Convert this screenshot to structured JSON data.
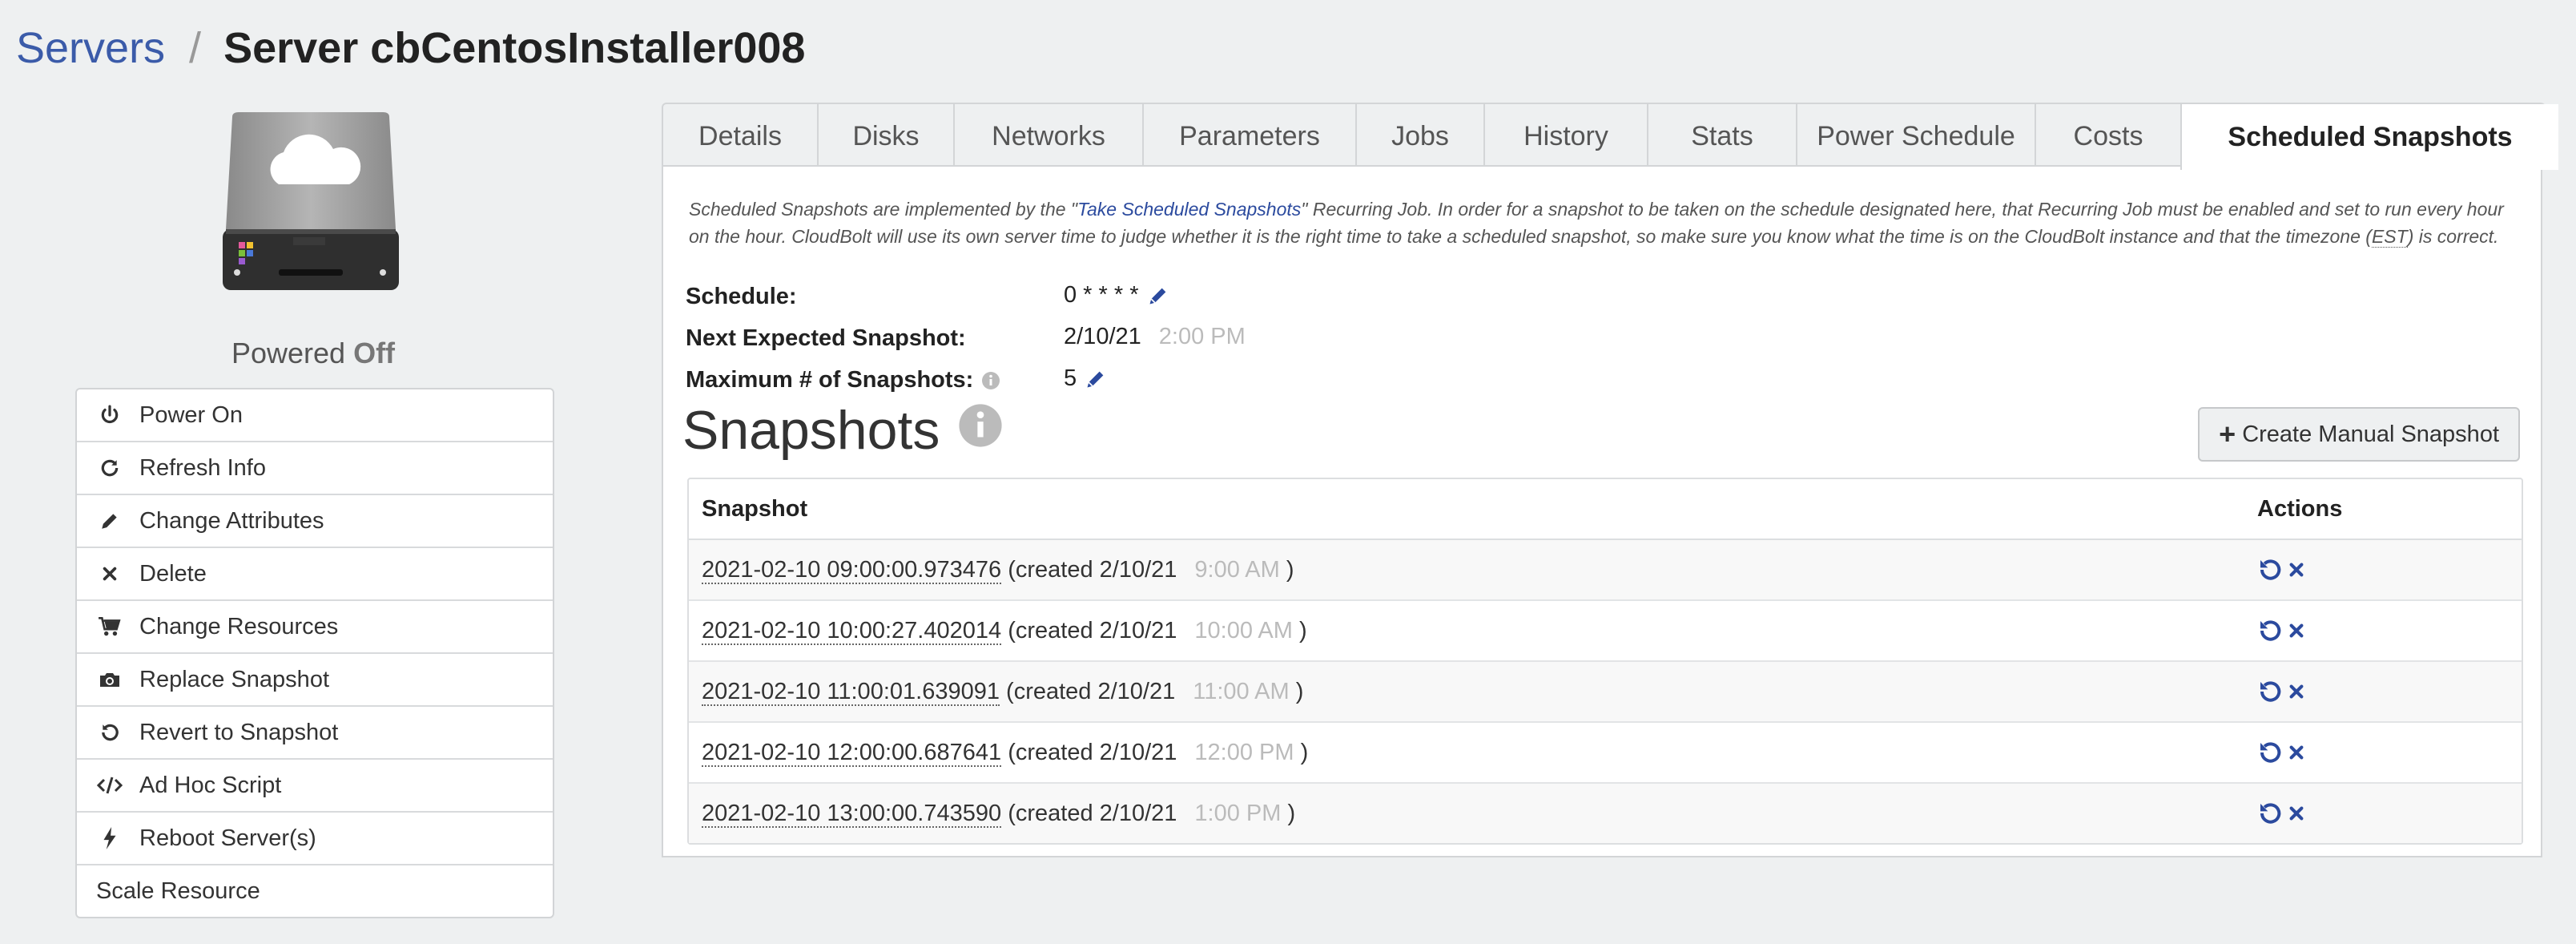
{
  "breadcrumb": {
    "parent": "Servers",
    "separator": "/",
    "title": "Server cbCentosInstaller008"
  },
  "server": {
    "power_prefix": "Powered",
    "power_state": "Off"
  },
  "actions": [
    {
      "label": "Power On",
      "icon": "power-icon"
    },
    {
      "label": "Refresh Info",
      "icon": "refresh-icon"
    },
    {
      "label": "Change Attributes",
      "icon": "pencil-icon"
    },
    {
      "label": "Delete",
      "icon": "close-icon"
    },
    {
      "label": "Change Resources",
      "icon": "cart-icon"
    },
    {
      "label": "Replace Snapshot",
      "icon": "camera-icon"
    },
    {
      "label": "Revert to Snapshot",
      "icon": "undo-icon"
    },
    {
      "label": "Ad Hoc Script",
      "icon": "code-icon"
    },
    {
      "label": "Reboot Server(s)",
      "icon": "bolt-icon"
    },
    {
      "label": "Scale Resource",
      "icon": ""
    }
  ],
  "tabs": [
    {
      "label": "Details"
    },
    {
      "label": "Disks"
    },
    {
      "label": "Networks"
    },
    {
      "label": "Parameters"
    },
    {
      "label": "Jobs"
    },
    {
      "label": "History"
    },
    {
      "label": "Stats"
    },
    {
      "label": "Power Schedule"
    },
    {
      "label": "Costs"
    },
    {
      "label": "Scheduled Snapshots"
    }
  ],
  "active_tab": "Scheduled Snapshots",
  "note": {
    "part1": "Scheduled Snapshots are implemented by the \"",
    "link": "Take Scheduled Snapshots",
    "part2": "\" Recurring Job. In order for a snapshot to be taken on the schedule designated here, that Recurring Job must be enabled and set to run every hour on the hour. CloudBolt will use its own server time to judge whether it is the right time to take a scheduled snapshot, so make sure you know what the time is on the CloudBolt instance and that the timezone (",
    "tz": "EST",
    "part3": ") is correct."
  },
  "fields": {
    "schedule_label": "Schedule:",
    "schedule_value": "0 * * * *",
    "next_label": "Next Expected Snapshot:",
    "next_date": "2/10/21",
    "next_time": "2:00 PM",
    "max_label": "Maximum # of Snapshots:",
    "max_value": "5"
  },
  "snapshots_section": {
    "title": "Snapshots",
    "create_button": "Create Manual Snapshot"
  },
  "table": {
    "headers": {
      "snapshot": "Snapshot",
      "actions": "Actions"
    },
    "rows": [
      {
        "name": "2021-02-10 09:00:00.973476",
        "created_prefix": "(created 2/10/21",
        "time": "9:00 AM",
        "suffix": ")"
      },
      {
        "name": "2021-02-10 10:00:27.402014",
        "created_prefix": "(created 2/10/21",
        "time": "10:00 AM",
        "suffix": ")"
      },
      {
        "name": "2021-02-10 11:00:01.639091",
        "created_prefix": "(created 2/10/21",
        "time": "11:00 AM",
        "suffix": ")"
      },
      {
        "name": "2021-02-10 12:00:00.687641",
        "created_prefix": "(created 2/10/21",
        "time": "12:00 PM",
        "suffix": ")"
      },
      {
        "name": "2021-02-10 13:00:00.743590",
        "created_prefix": "(created 2/10/21",
        "time": "1:00 PM",
        "suffix": ")"
      }
    ]
  },
  "colors": {
    "link": "#3b5ba9",
    "icon_blue": "#2b4a9e",
    "background": "#eef0f1"
  }
}
